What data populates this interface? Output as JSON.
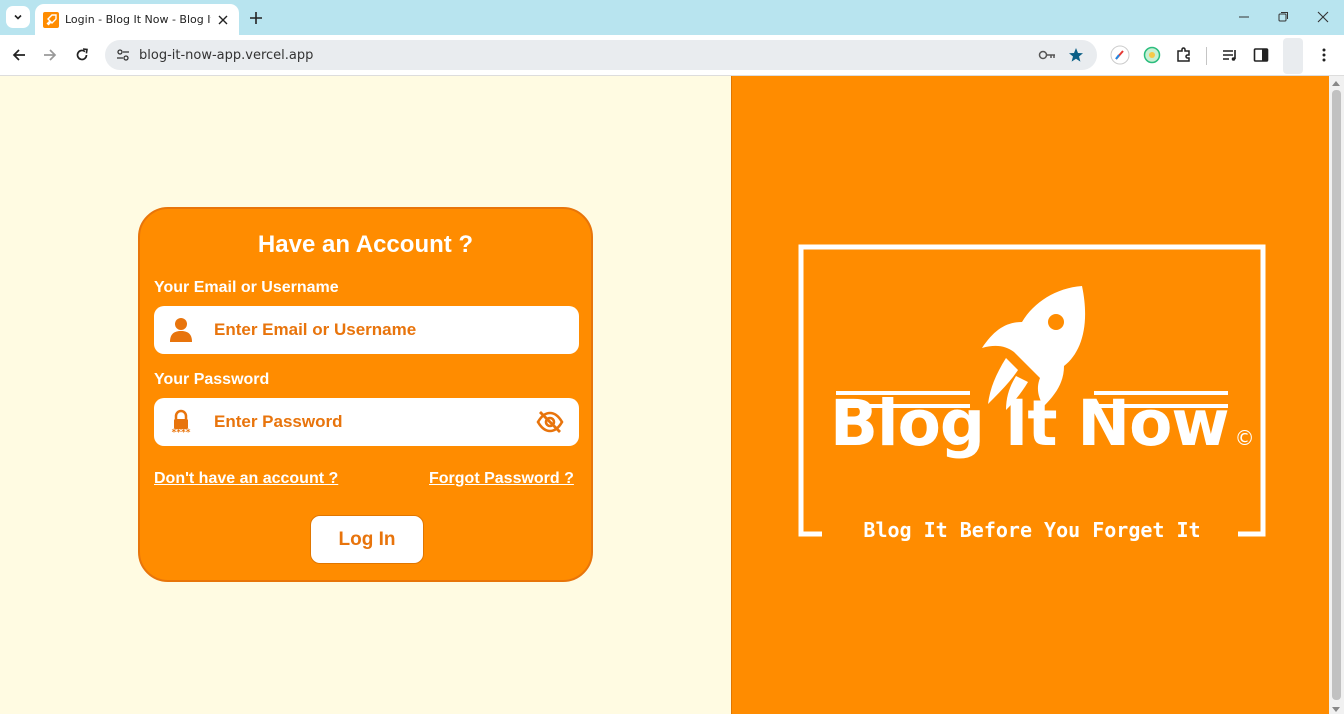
{
  "browser": {
    "tab_title": "Login - Blog It Now - Blog It Be",
    "url": "blog-it-now-app.vercel.app"
  },
  "login": {
    "heading": "Have an Account ?",
    "email_label": "Your Email or Username",
    "email_placeholder": "Enter Email or Username",
    "password_label": "Your Password",
    "password_placeholder": "Enter Password",
    "signup_link": "Don't have an account ?",
    "forgot_link": "Forgot Password ?",
    "login_button": "Log In"
  },
  "brand": {
    "name": "Blog It Now",
    "copyright": "©",
    "tagline": "Blog It Before You Forget It"
  },
  "colors": {
    "accent": "#ff8c00",
    "background_left": "#fffbe2",
    "tab_strip": "#b8e4ef"
  },
  "icons": [
    "tab-list-icon",
    "favicon-icon",
    "close-icon",
    "plus-icon",
    "minimize-icon",
    "restore-icon",
    "close-window-icon",
    "back-icon",
    "forward-icon",
    "reload-icon",
    "site-info-icon",
    "key-icon",
    "star-icon",
    "pen-icon",
    "ext-icon",
    "puzzle-icon",
    "media-icon",
    "sidepanel-icon",
    "more-icon",
    "user-icon",
    "lock-icon",
    "eye-off-icon",
    "rocket-icon"
  ]
}
